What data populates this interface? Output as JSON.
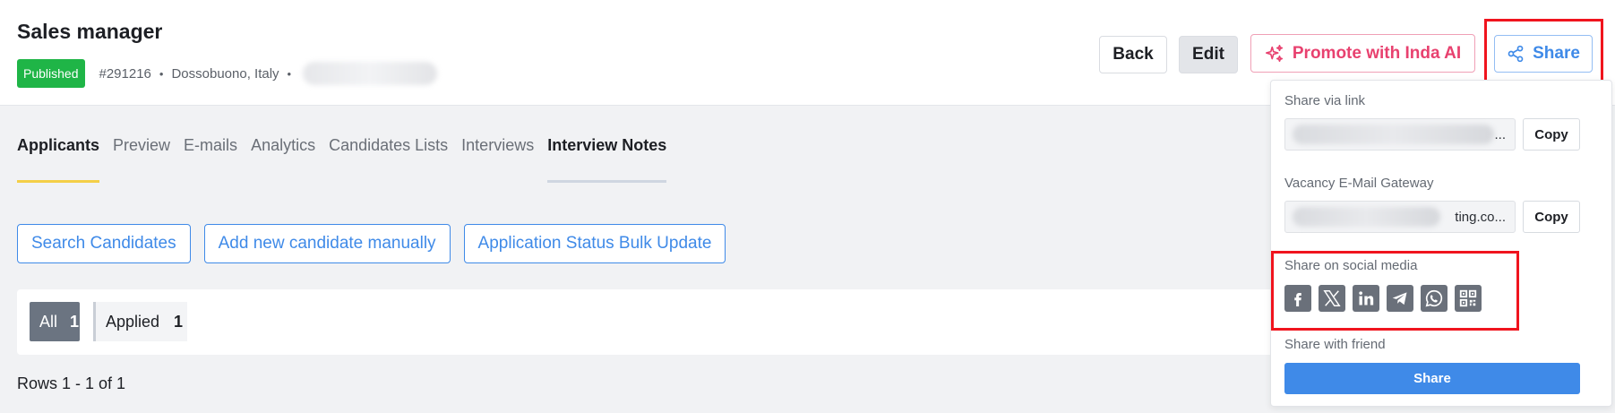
{
  "job": {
    "title": "Sales manager",
    "status": "Published",
    "id": "#291216",
    "location": "Dossobuono, Italy",
    "separator": "•"
  },
  "header_actions": {
    "back": "Back",
    "edit": "Edit",
    "promote": "Promote with Inda AI",
    "share": "Share"
  },
  "tabs": [
    "Applicants",
    "Preview",
    "E-mails",
    "Analytics",
    "Candidates Lists",
    "Interviews",
    "Interview Notes"
  ],
  "actions": [
    "Search Candidates",
    "Add new candidate manually",
    "Application Status Bulk Update"
  ],
  "filters": {
    "all_label": "All",
    "all_count": "1",
    "applied_label": "Applied",
    "applied_count": "1"
  },
  "rows_info": "Rows 1 - 1 of 1",
  "share_menu": {
    "via_link_label": "Share via link",
    "via_link_value": "...",
    "gateway_label": "Vacancy E-Mail Gateway",
    "gateway_value": "ting.co...",
    "copy": "Copy",
    "social_label": "Share on social media",
    "social_icons": [
      "facebook-icon",
      "x-icon",
      "linkedin-icon",
      "telegram-icon",
      "whatsapp-icon",
      "qr-code-icon"
    ],
    "friend_label": "Share with friend",
    "friend_button": "Share"
  },
  "colors": {
    "published": "#1fb547",
    "accent_blue": "#3f8ae8",
    "promote_pink": "#e8416f",
    "highlight_red": "#f0141e",
    "active_tab_underline": "#f4cf47"
  }
}
